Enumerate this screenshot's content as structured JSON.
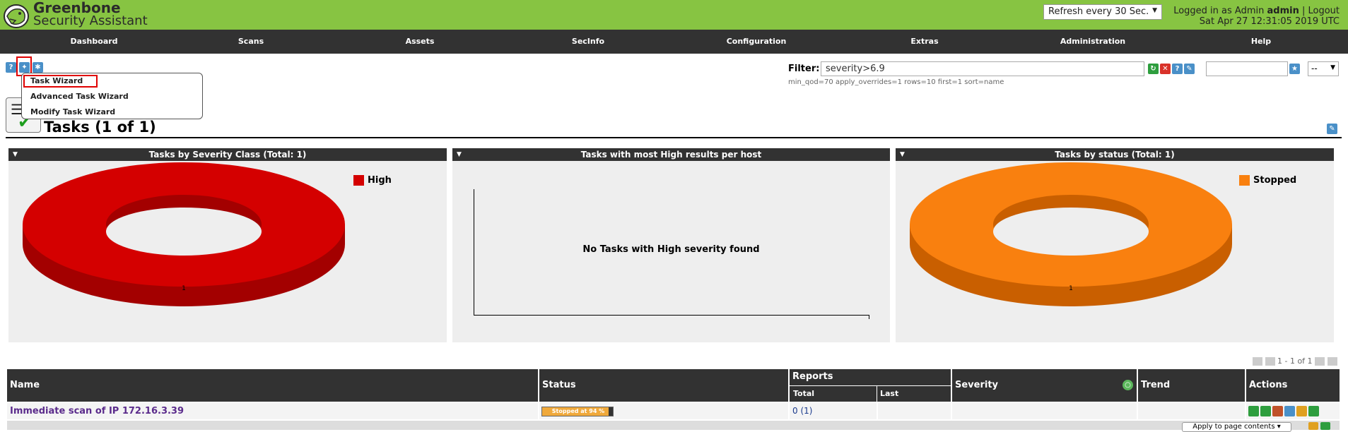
{
  "header": {
    "brand_line1": "Greenbone",
    "brand_line2": "Security Assistant",
    "refresh_selected": "Refresh every 30 Sec.",
    "logged_in_prefix": "Logged in as  Admin",
    "user": "admin",
    "logout": "Logout",
    "datetime": "Sat Apr 27 12:31:05 2019 UTC"
  },
  "nav": {
    "items": [
      "Dashboard",
      "Scans",
      "Assets",
      "SecInfo",
      "Configuration",
      "Extras",
      "Administration",
      "Help"
    ]
  },
  "wizard_menu": {
    "items": [
      "Task Wizard",
      "Advanced Task Wizard",
      "Modify Task Wizard"
    ]
  },
  "filter": {
    "label": "Filter:",
    "value": "severity>6.9",
    "params": "min_qod=70 apply_overrides=1 rows=10 first=1 sort=name",
    "select_value": "--"
  },
  "page": {
    "title": "Tasks (1 of 1)"
  },
  "panels": {
    "severity": {
      "title": "Tasks by Severity Class (Total: 1)",
      "legend": "High",
      "slice_label": "1",
      "color": "#d40000"
    },
    "high_results": {
      "title": "Tasks with most High results per host",
      "message": "No Tasks with High severity found"
    },
    "status": {
      "title": "Tasks by status (Total: 1)",
      "legend": "Stopped",
      "slice_label": "1",
      "color": "#f9800f"
    }
  },
  "pager": {
    "text": "1 - 1 of 1"
  },
  "table": {
    "headers": {
      "name": "Name",
      "status": "Status",
      "reports": "Reports",
      "total": "Total",
      "last": "Last",
      "severity": "Severity",
      "trend": "Trend",
      "actions": "Actions"
    },
    "rows": [
      {
        "name": "Immediate scan of IP 172.16.3.39",
        "status": "Stopped at 94 %",
        "progress": 94,
        "reports_total": "0",
        "reports_link": "(1)"
      }
    ],
    "apply_select": "Apply to page contents"
  }
}
